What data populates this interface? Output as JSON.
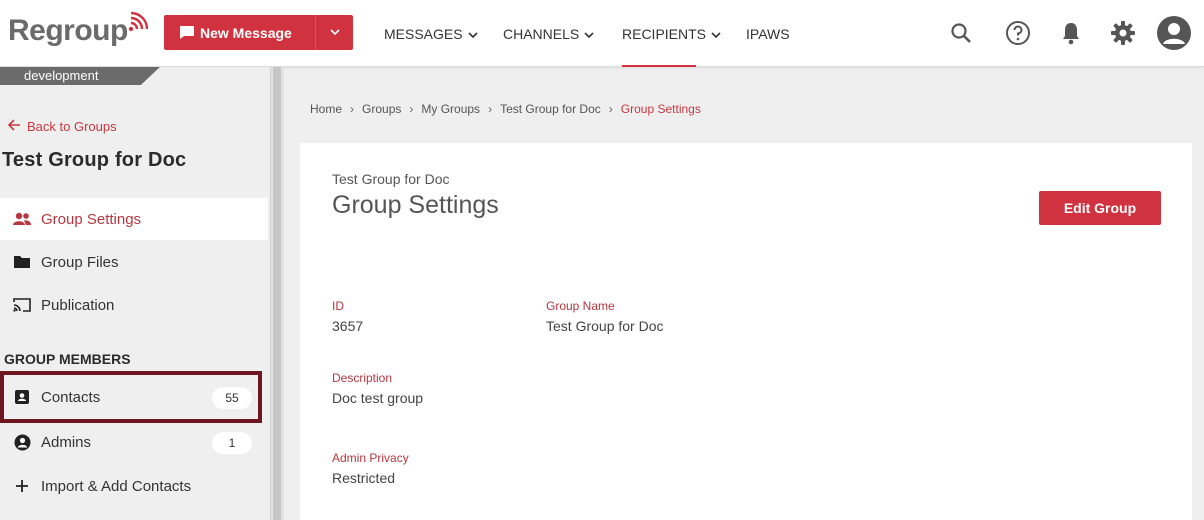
{
  "brand": {
    "logo_text": "Regroup",
    "accent": "#d1323f",
    "dark_accent": "#6e1721"
  },
  "header": {
    "new_message_label": "New Message",
    "nav": [
      {
        "label": "MESSAGES",
        "has_dropdown": true,
        "active": false
      },
      {
        "label": "CHANNELS",
        "has_dropdown": true,
        "active": false
      },
      {
        "label": "RECIPIENTS",
        "has_dropdown": true,
        "active": true
      },
      {
        "label": "IPAWS",
        "has_dropdown": false,
        "active": false
      }
    ],
    "icons": [
      "search-icon",
      "help-icon",
      "bell-icon",
      "gear-icon",
      "user-avatar-icon"
    ]
  },
  "sidebar": {
    "environment": "development",
    "back_label": "Back to Groups",
    "group_title": "Test Group for Doc",
    "items": [
      {
        "label": "Group Settings",
        "icon": "people-icon",
        "active": true
      },
      {
        "label": "Group Files",
        "icon": "folder-icon",
        "active": false
      },
      {
        "label": "Publication",
        "icon": "cast-icon",
        "active": false
      }
    ],
    "section_title": "GROUP MEMBERS",
    "members": [
      {
        "label": "Contacts",
        "icon": "contact-card-icon",
        "count": "55"
      },
      {
        "label": "Admins",
        "icon": "user-circle-icon",
        "count": "1"
      },
      {
        "label": "Import & Add Contacts",
        "icon": "plus-icon",
        "count": null
      }
    ]
  },
  "breadcrumb": [
    "Home",
    "Groups",
    "My Groups",
    "Test Group for Doc",
    "Group Settings"
  ],
  "main": {
    "subtitle": "Test Group for Doc",
    "title": "Group Settings",
    "edit_label": "Edit Group",
    "fields": {
      "id": {
        "label": "ID",
        "value": "3657"
      },
      "group_name": {
        "label": "Group Name",
        "value": "Test Group for Doc"
      },
      "description": {
        "label": "Description",
        "value": "Doc test group"
      },
      "admin_privacy": {
        "label": "Admin Privacy",
        "value": "Restricted"
      }
    }
  }
}
